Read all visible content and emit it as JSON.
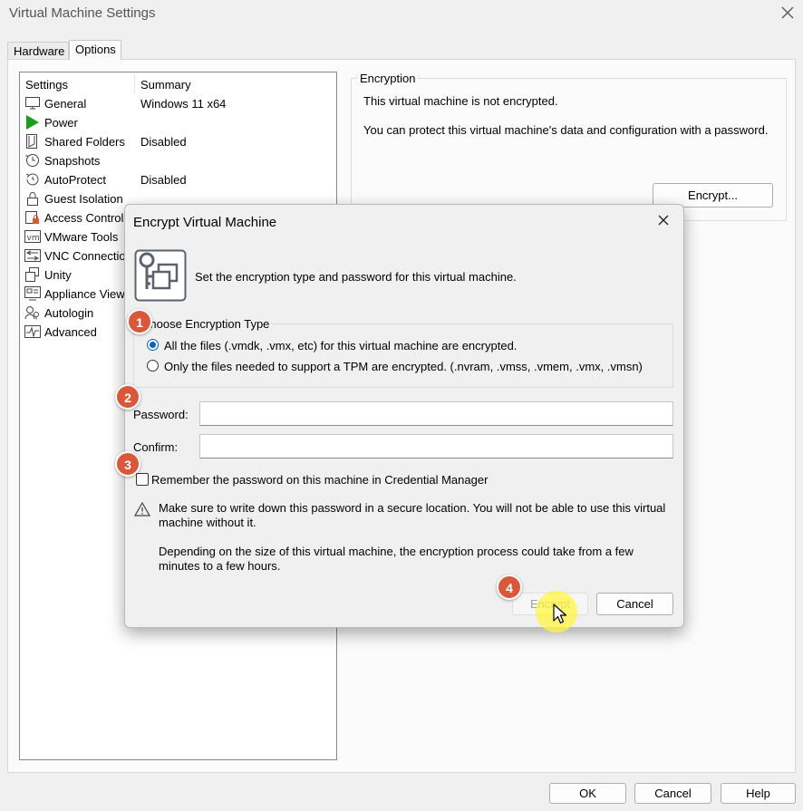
{
  "window": {
    "title": "Virtual Machine Settings",
    "close_icon": "close-icon"
  },
  "tabs": [
    {
      "label": "Hardware"
    },
    {
      "label": "Options",
      "selected": true
    }
  ],
  "settings_list": {
    "headers": {
      "settings": "Settings",
      "summary": "Summary"
    },
    "items": [
      {
        "label": "General",
        "summary": "Windows 11 x64",
        "icon": "monitor-icon"
      },
      {
        "label": "Power",
        "summary": "",
        "icon": "play-icon"
      },
      {
        "label": "Shared Folders",
        "summary": "Disabled",
        "icon": "folder-share-icon"
      },
      {
        "label": "Snapshots",
        "summary": "",
        "icon": "clock-icon"
      },
      {
        "label": "AutoProtect",
        "summary": "Disabled",
        "icon": "history-icon"
      },
      {
        "label": "Guest Isolation",
        "summary": "",
        "icon": "lock-icon"
      },
      {
        "label": "Access Control",
        "summary": "",
        "icon": "access-lock-icon"
      },
      {
        "label": "VMware Tools",
        "summary": "",
        "icon": "vm-icon"
      },
      {
        "label": "VNC Connections",
        "summary": "",
        "icon": "vnc-icon"
      },
      {
        "label": "Unity",
        "summary": "",
        "icon": "unity-icon"
      },
      {
        "label": "Appliance View",
        "summary": "",
        "icon": "appliance-icon"
      },
      {
        "label": "Autologin",
        "summary": "",
        "icon": "user-key-icon"
      },
      {
        "label": "Advanced",
        "summary": "",
        "icon": "pulse-icon"
      }
    ]
  },
  "encryption_panel": {
    "title": "Encryption",
    "status": "This virtual machine is not encrypted.",
    "description": "You can protect this virtual machine's data and configuration with a password.",
    "encrypt_button": "Encrypt..."
  },
  "footer": {
    "ok": "OK",
    "cancel": "Cancel",
    "help": "Help"
  },
  "dialog": {
    "title": "Encrypt Virtual Machine",
    "intro": "Set the encryption type and password for this virtual machine.",
    "group_title": "Choose Encryption Type",
    "option_all": "All the files (.vmdk, .vmx, etc) for this virtual machine are encrypted.",
    "option_tpm": "Only the files needed to support a TPM are encrypted. (.nvram, .vmss, .vmem, .vmx, .vmsn)",
    "selected_option": "all",
    "password_label": "Password:",
    "password_value": "",
    "confirm_label": "Confirm:",
    "confirm_value": "",
    "remember_label": "Remember the password on this machine in Credential Manager",
    "remember_checked": false,
    "warning_1": "Make sure to write down this password in a secure location. You will not be able to use this virtual machine without it.",
    "warning_2": "Depending on the size of this virtual machine, the encryption process could take from a few minutes to a few hours.",
    "encrypt_button": "Encrypt",
    "encrypt_enabled": false,
    "cancel_button": "Cancel"
  },
  "annotations": [
    "1",
    "2",
    "3",
    "4"
  ],
  "colors": {
    "accent": "#0067c0",
    "step_badge": "#d9583c",
    "highlight": "#fff640",
    "play_green": "#1a9e1a"
  }
}
